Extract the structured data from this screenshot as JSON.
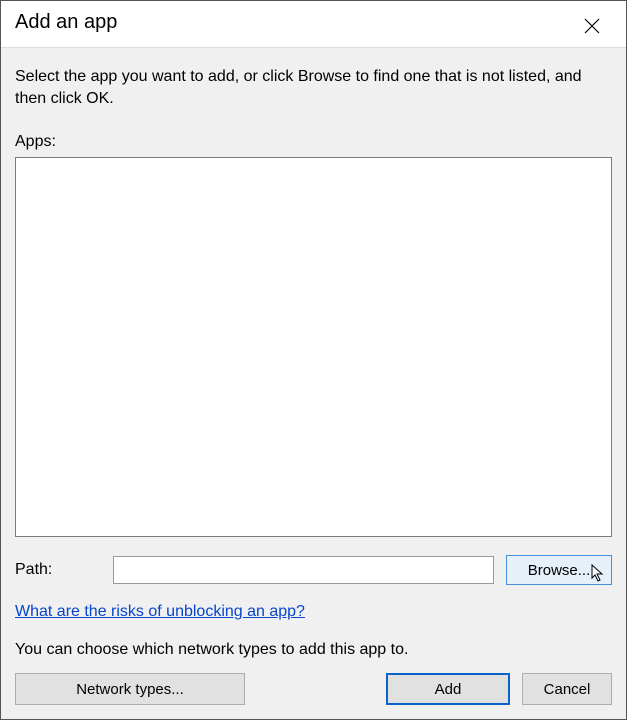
{
  "window": {
    "title": "Add an app"
  },
  "content": {
    "instruction": "Select the app you want to add, or click Browse to find one that is not listed, and then click OK.",
    "apps_label": "Apps:",
    "path_label": "Path:",
    "path_value": "",
    "browse_label": "Browse...",
    "risk_link": "What are the risks of unblocking an app?",
    "network_text": "You can choose which network types to add this app to.",
    "network_types_label": "Network types...",
    "add_label": "Add",
    "cancel_label": "Cancel"
  }
}
